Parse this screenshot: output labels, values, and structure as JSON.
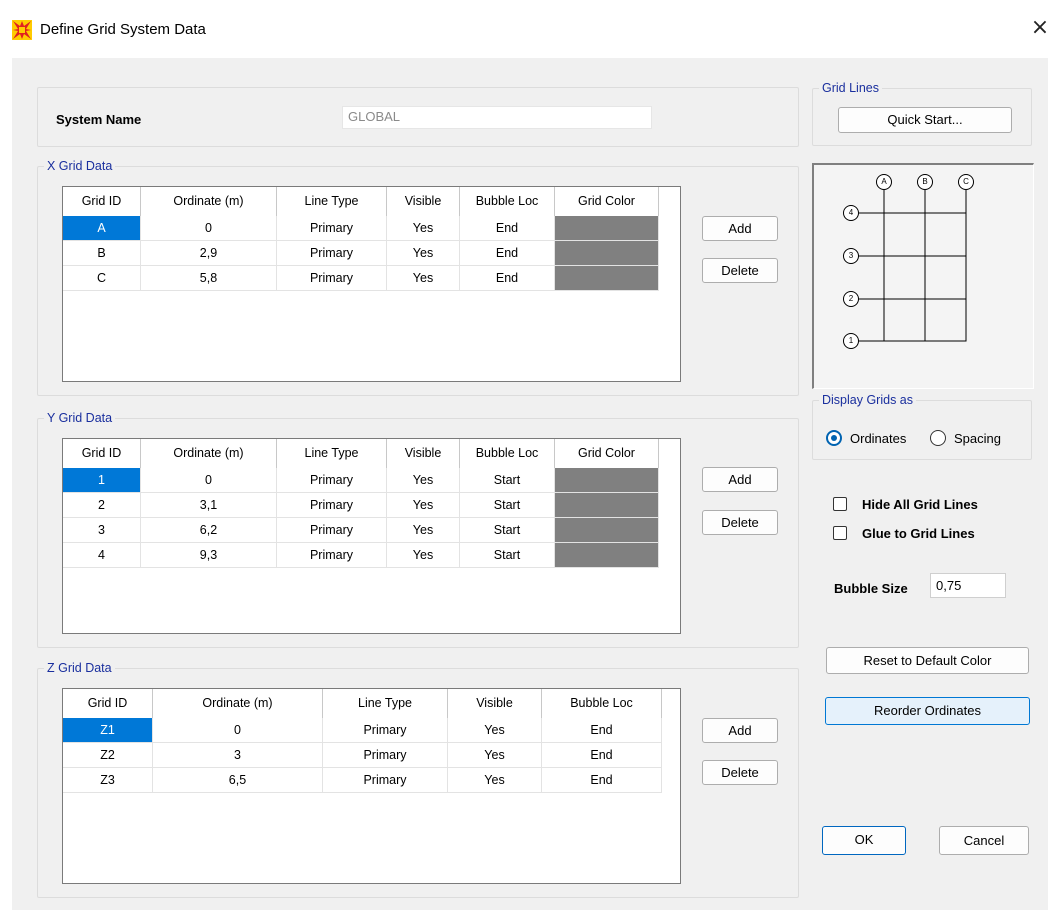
{
  "window": {
    "title": "Define Grid System Data",
    "close_glyph": "×",
    "app_icon": "csi-app-icon"
  },
  "system": {
    "label": "System Name",
    "value": "GLOBAL"
  },
  "x_grid": {
    "legend": "X Grid Data",
    "headers": [
      "Grid ID",
      "Ordinate (m)",
      "Line Type",
      "Visible",
      "Bubble Loc",
      "Grid Color"
    ],
    "rows": [
      [
        "A",
        "0",
        "Primary",
        "Yes",
        "End"
      ],
      [
        "B",
        "2,9",
        "Primary",
        "Yes",
        "End"
      ],
      [
        "C",
        "5,8",
        "Primary",
        "Yes",
        "End"
      ]
    ],
    "add_label": "Add",
    "delete_label": "Delete"
  },
  "y_grid": {
    "legend": "Y Grid Data",
    "headers": [
      "Grid ID",
      "Ordinate (m)",
      "Line Type",
      "Visible",
      "Bubble Loc",
      "Grid Color"
    ],
    "rows": [
      [
        "1",
        "0",
        "Primary",
        "Yes",
        "Start"
      ],
      [
        "2",
        "3,1",
        "Primary",
        "Yes",
        "Start"
      ],
      [
        "3",
        "6,2",
        "Primary",
        "Yes",
        "Start"
      ],
      [
        "4",
        "9,3",
        "Primary",
        "Yes",
        "Start"
      ]
    ],
    "add_label": "Add",
    "delete_label": "Delete"
  },
  "z_grid": {
    "legend": "Z Grid Data",
    "headers": [
      "Grid ID",
      "Ordinate (m)",
      "Line Type",
      "Visible",
      "Bubble Loc"
    ],
    "rows": [
      [
        "Z1",
        "0",
        "Primary",
        "Yes",
        "End"
      ],
      [
        "Z2",
        "3",
        "Primary",
        "Yes",
        "End"
      ],
      [
        "Z3",
        "6,5",
        "Primary",
        "Yes",
        "End"
      ]
    ],
    "add_label": "Add",
    "delete_label": "Delete"
  },
  "grid_lines": {
    "legend": "Grid Lines",
    "quick_start_label": "Quick Start..."
  },
  "preview": {
    "x_bubbles": [
      "A",
      "B",
      "C"
    ],
    "y_bubbles": [
      "4",
      "3",
      "2",
      "1"
    ]
  },
  "display": {
    "legend": "Display Grids as",
    "ordinates_label": "Ordinates",
    "spacing_label": "Spacing",
    "selected": "Ordinates"
  },
  "options": {
    "hide_all_label": "Hide All Grid Lines",
    "glue_label": "Glue to Grid Lines",
    "bubble_size_label": "Bubble Size",
    "bubble_size_value": "0,75"
  },
  "actions": {
    "reset_color_label": "Reset to Default Color",
    "reorder_label": "Reorder Ordinates",
    "ok_label": "OK",
    "cancel_label": "Cancel"
  },
  "colors": {
    "grid_color_swatch": "#808080",
    "selection": "#0078d7",
    "legend_text": "#1a2f9e"
  }
}
